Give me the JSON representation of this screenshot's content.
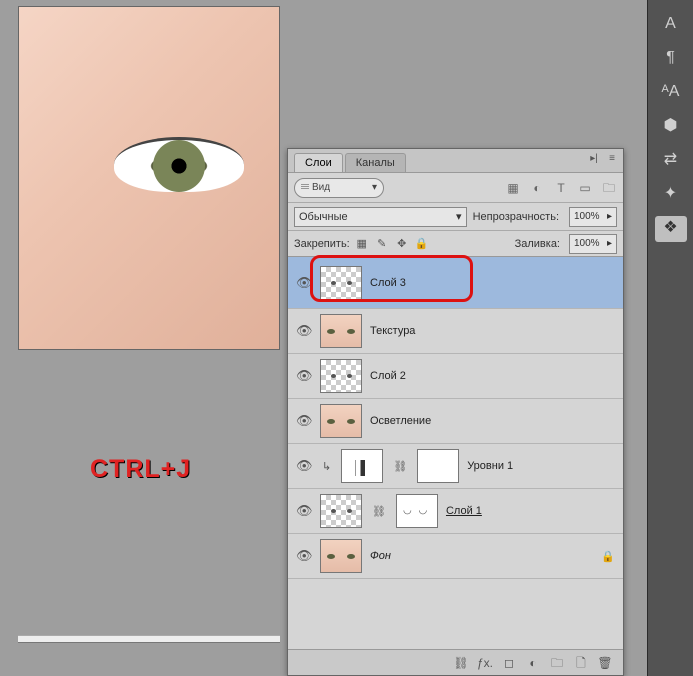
{
  "overlay_shortcut": "CTRL+J",
  "right_tools": [
    {
      "name": "type-icon",
      "glyph": "A"
    },
    {
      "name": "paragraph-icon",
      "glyph": "¶"
    },
    {
      "name": "char-style-icon",
      "glyph": "ᴬA"
    },
    {
      "name": "cube-icon",
      "glyph": "⬢"
    },
    {
      "name": "swap-icon",
      "glyph": "⇄"
    },
    {
      "name": "wand-icon",
      "glyph": "✦"
    },
    {
      "name": "layers-icon",
      "glyph": "❖",
      "active": true
    }
  ],
  "panel": {
    "tabs": [
      {
        "label": "Слои",
        "active": true
      },
      {
        "label": "Каналы",
        "active": false
      }
    ],
    "collapse_icon": "▸|",
    "menu_icon": "≡",
    "filter": {
      "search_icon": "𝄘",
      "label": "Вид",
      "dropdown_icon": "▾",
      "icons": [
        {
          "name": "pixel-filter-icon",
          "glyph": "▦"
        },
        {
          "name": "adjust-filter-icon",
          "glyph": "◐"
        },
        {
          "name": "type-filter-icon",
          "glyph": "T"
        },
        {
          "name": "shape-filter-icon",
          "glyph": "▭"
        },
        {
          "name": "smart-filter-icon",
          "glyph": "🗀"
        }
      ]
    },
    "blend": {
      "mode": "Обычные",
      "dropdown_icon": "▾",
      "opacity_label": "Непрозрачность:",
      "opacity_value": "100%",
      "caret": "▸"
    },
    "lock": {
      "label": "Закрепить:",
      "icons": [
        {
          "name": "lock-trans-icon",
          "glyph": "▦"
        },
        {
          "name": "lock-brush-icon",
          "glyph": "✎"
        },
        {
          "name": "lock-move-icon",
          "glyph": "✥"
        },
        {
          "name": "lock-all-icon",
          "glyph": "🔒"
        }
      ],
      "fill_label": "Заливка:",
      "fill_value": "100%",
      "caret": "▸"
    },
    "layers": [
      {
        "name": "Слой 3",
        "visible": true,
        "selected": true,
        "thumb": "checker dots",
        "highlight": true
      },
      {
        "name": "Текстура",
        "visible": true,
        "thumb": "face"
      },
      {
        "name": "Слой 2",
        "visible": true,
        "thumb": "checker dots"
      },
      {
        "name": "Осветление",
        "visible": true,
        "thumb": "face"
      },
      {
        "name": "Уровни 1",
        "visible": true,
        "thumb": "levels",
        "mask": "white",
        "adjustment": true
      },
      {
        "name": "Слой 1",
        "visible": true,
        "thumb": "checker dots",
        "mask": "arcs",
        "underline": true,
        "linked": true
      },
      {
        "name": "Фон",
        "visible": true,
        "thumb": "face",
        "italic": true,
        "locked": true
      }
    ],
    "footer_icons": [
      {
        "name": "link-icon",
        "glyph": "⛓"
      },
      {
        "name": "fx-icon",
        "glyph": "ƒx."
      },
      {
        "name": "mask-icon",
        "glyph": "◻"
      },
      {
        "name": "adjust-icon",
        "glyph": "◐"
      },
      {
        "name": "group-icon",
        "glyph": "🗀"
      },
      {
        "name": "new-icon",
        "glyph": "🗋"
      },
      {
        "name": "trash-icon",
        "glyph": "🗑"
      }
    ]
  }
}
